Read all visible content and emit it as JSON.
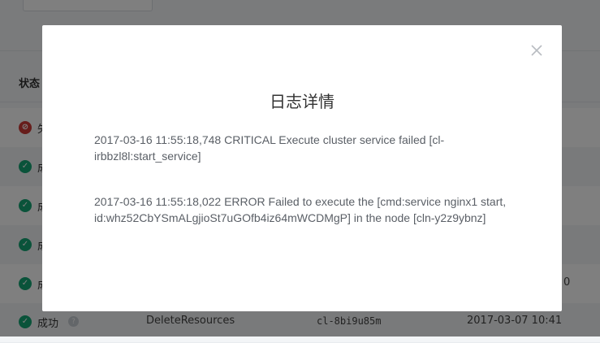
{
  "background": {
    "table_header": {
      "status_label": "状态"
    },
    "rows": [
      {
        "status": "fail",
        "icon": "fail-icon",
        "status_text": "失"
      },
      {
        "status": "ok",
        "icon": "check-icon",
        "status_text": "成"
      },
      {
        "status": "ok",
        "icon": "check-icon",
        "status_text": "成"
      },
      {
        "status": "ok",
        "icon": "check-icon",
        "status_text": "成"
      },
      {
        "status": "ok",
        "icon": "check-icon",
        "status_text": "成",
        "edge_fragment": "0"
      },
      {
        "status": "ok",
        "icon": "check-icon",
        "status_text": "成功",
        "job": "DeleteResources",
        "resource": "cl-8bi9u85m",
        "time": "2017-03-07 10:41"
      }
    ]
  },
  "modal": {
    "title": "日志详情",
    "close_icon": "close-icon",
    "log_entries": [
      "2017-03-16 11:55:18,748 CRITICAL Execute cluster service failed [cl-irbbzl8l:start_service]",
      "2017-03-16 11:55:18,022 ERROR Failed to execute the [cmd:service nginx1 start, id:whz52CbYSmALgjioSt7uGOfb4iz64mWCDMgP] in the node [cln-y2z9ybnz]"
    ]
  },
  "colors": {
    "success": "#15a675",
    "failure": "#cf3b37",
    "overlay": "rgba(0,0,0,0.5)",
    "modal_text": "#5a5f66"
  }
}
